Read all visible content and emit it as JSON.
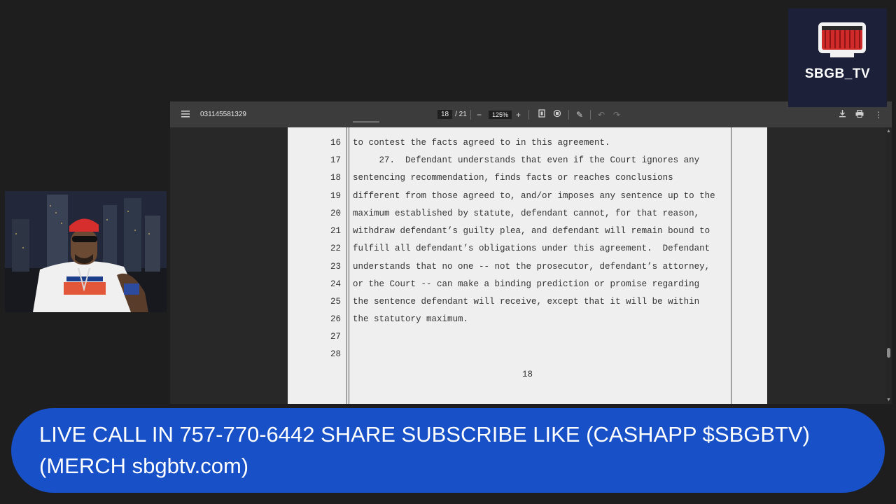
{
  "pdf_viewer": {
    "document_title": "031145581329",
    "current_page": "18",
    "total_pages": "/ 21",
    "zoom": "125%",
    "icons": {
      "menu": "menu-icon",
      "zoom_out": "minus-icon",
      "zoom_in": "plus-icon",
      "fit_page": "fit-page-icon",
      "rotate": "rotate-icon",
      "annotate": "pen-icon",
      "undo": "undo-icon",
      "redo": "redo-icon",
      "download": "download-icon",
      "print": "print-icon",
      "more": "more-vertical-icon"
    }
  },
  "document": {
    "lines": [
      {
        "num": "16",
        "text": "to contest the facts agreed to in this agreement."
      },
      {
        "num": "17",
        "text": "     27.  Defendant understands that even if the Court ignores any"
      },
      {
        "num": "18",
        "text": "sentencing recommendation, finds facts or reaches conclusions"
      },
      {
        "num": "19",
        "text": "different from those agreed to, and/or imposes any sentence up to the"
      },
      {
        "num": "20",
        "text": "maximum established by statute, defendant cannot, for that reason,"
      },
      {
        "num": "21",
        "text": "withdraw defendant’s guilty plea, and defendant will remain bound to"
      },
      {
        "num": "22",
        "text": "fulfill all defendant’s obligations under this agreement.  Defendant"
      },
      {
        "num": "23",
        "text": "understands that no one -- not the prosecutor, defendant’s attorney,"
      },
      {
        "num": "24",
        "text": "or the Court -- can make a binding prediction or promise regarding"
      },
      {
        "num": "25",
        "text": "the sentence defendant will receive, except that it will be within"
      },
      {
        "num": "26",
        "text": "the statutory maximum."
      },
      {
        "num": "27",
        "text": ""
      },
      {
        "num": "28",
        "text": ""
      }
    ],
    "page_number": "18"
  },
  "logo": {
    "text": "SBGB_TV"
  },
  "banner": {
    "line1": "LIVE CALL IN 757-770-6442 SHARE SUBSCRIBE LIKE (CASHAPP $SBGBTV)",
    "line2": "(MERCH sbgbtv.com)",
    "color": "#1850c8"
  }
}
